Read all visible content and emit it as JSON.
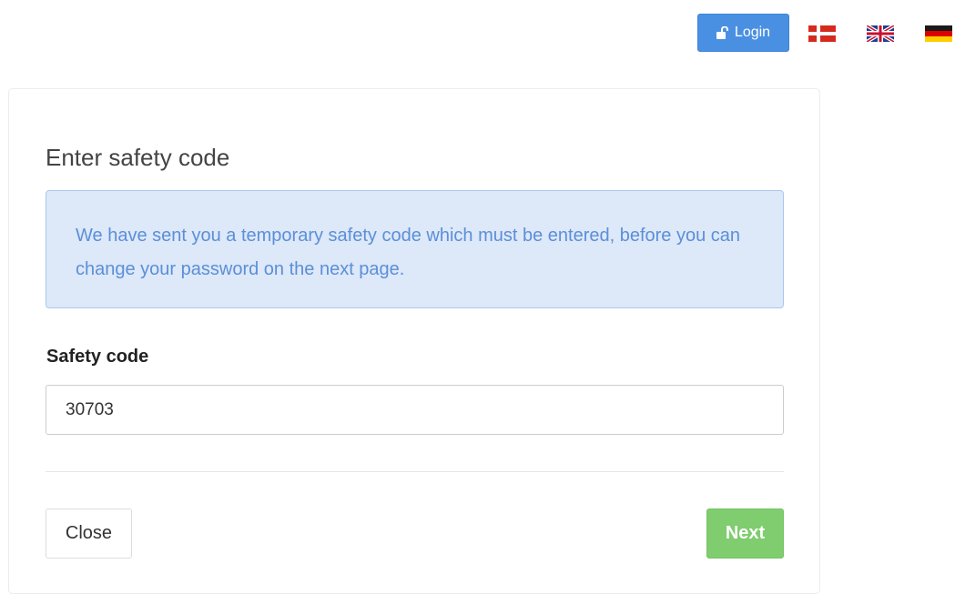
{
  "header": {
    "login_label": "Login",
    "login_icon": "unlock-icon",
    "languages": [
      {
        "code": "da",
        "icon": "flag-denmark-icon"
      },
      {
        "code": "en",
        "icon": "flag-uk-icon"
      },
      {
        "code": "de",
        "icon": "flag-germany-icon"
      }
    ]
  },
  "form": {
    "title": "Enter safety code",
    "info_text": "We have sent you a temporary safety code which must be entered, before you can change your password on the next page.",
    "field_label": "Safety code",
    "field_value": "30703",
    "close_label": "Close",
    "next_label": "Next"
  },
  "colors": {
    "primary": "#4a90e2",
    "success": "#7fcd6e",
    "info_background": "#dde8f8",
    "info_text": "#5b8fd8"
  }
}
